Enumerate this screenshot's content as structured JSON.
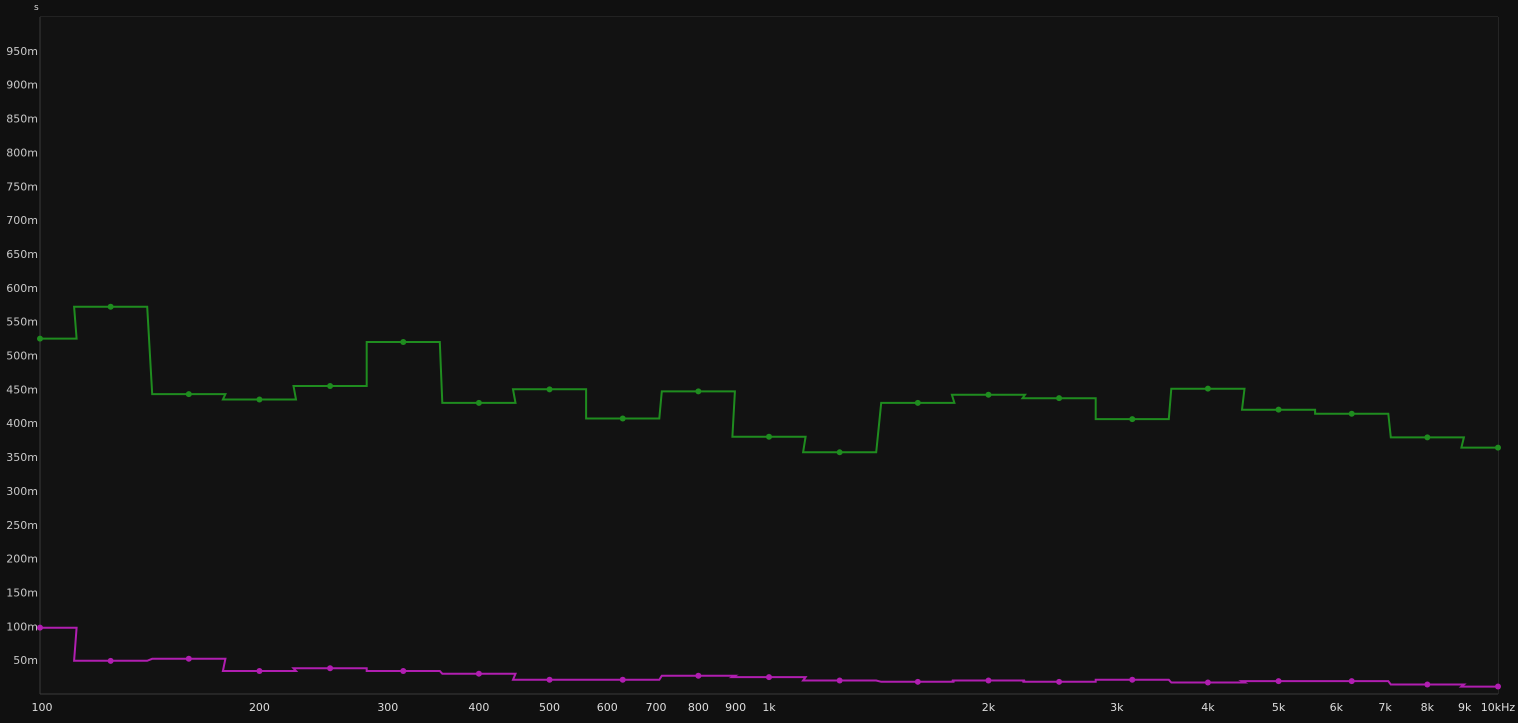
{
  "chart_data": {
    "type": "line",
    "step": true,
    "x_scale": "log",
    "y_unit_label": "s",
    "xlim": [
      100,
      10000
    ],
    "ylim": [
      0,
      1
    ],
    "grid": true,
    "background_color": "#101010",
    "x_ticks": [
      {
        "value": 100,
        "label": "100"
      },
      {
        "value": 200,
        "label": "200"
      },
      {
        "value": 300,
        "label": "300"
      },
      {
        "value": 400,
        "label": "400"
      },
      {
        "value": 500,
        "label": "500"
      },
      {
        "value": 600,
        "label": "600"
      },
      {
        "value": 700,
        "label": "700"
      },
      {
        "value": 800,
        "label": "800"
      },
      {
        "value": 900,
        "label": "900"
      },
      {
        "value": 1000,
        "label": "1k"
      },
      {
        "value": 2000,
        "label": "2k"
      },
      {
        "value": 3000,
        "label": "3k"
      },
      {
        "value": 4000,
        "label": "4k"
      },
      {
        "value": 5000,
        "label": "5k"
      },
      {
        "value": 6000,
        "label": "6k"
      },
      {
        "value": 7000,
        "label": "7k"
      },
      {
        "value": 8000,
        "label": "8k"
      },
      {
        "value": 9000,
        "label": "9k"
      },
      {
        "value": 10000,
        "label": "10kHz"
      }
    ],
    "y_ticks": [
      {
        "value": 0.05,
        "label": "50m"
      },
      {
        "value": 0.1,
        "label": "100m"
      },
      {
        "value": 0.15,
        "label": "150m"
      },
      {
        "value": 0.2,
        "label": "200m"
      },
      {
        "value": 0.25,
        "label": "250m"
      },
      {
        "value": 0.3,
        "label": "300m"
      },
      {
        "value": 0.35,
        "label": "350m"
      },
      {
        "value": 0.4,
        "label": "400m"
      },
      {
        "value": 0.45,
        "label": "450m"
      },
      {
        "value": 0.5,
        "label": "500m"
      },
      {
        "value": 0.55,
        "label": "550m"
      },
      {
        "value": 0.6,
        "label": "600m"
      },
      {
        "value": 0.65,
        "label": "650m"
      },
      {
        "value": 0.7,
        "label": "700m"
      },
      {
        "value": 0.75,
        "label": "750m"
      },
      {
        "value": 0.8,
        "label": "800m"
      },
      {
        "value": 0.85,
        "label": "850m"
      },
      {
        "value": 0.9,
        "label": "900m"
      },
      {
        "value": 0.95,
        "label": "950m"
      }
    ],
    "band_centers_hz": [
      100,
      125,
      160,
      200,
      250,
      315,
      400,
      500,
      630,
      800,
      1000,
      1250,
      1600,
      2000,
      2500,
      3150,
      4000,
      5000,
      6300,
      8000,
      10000
    ],
    "series": [
      {
        "color": "#1f8c1f",
        "values": [
          0.525,
          0.572,
          0.443,
          0.435,
          0.455,
          0.52,
          0.43,
          0.45,
          0.407,
          0.447,
          0.38,
          0.357,
          0.43,
          0.442,
          0.437,
          0.406,
          0.451,
          0.42,
          0.414,
          0.379,
          0.364
        ]
      },
      {
        "color": "#b01eb0",
        "values": [
          0.098,
          0.049,
          0.052,
          0.034,
          0.038,
          0.034,
          0.03,
          0.021,
          0.021,
          0.027,
          0.025,
          0.02,
          0.018,
          0.02,
          0.018,
          0.021,
          0.017,
          0.019,
          0.019,
          0.014,
          0.011
        ]
      }
    ]
  }
}
